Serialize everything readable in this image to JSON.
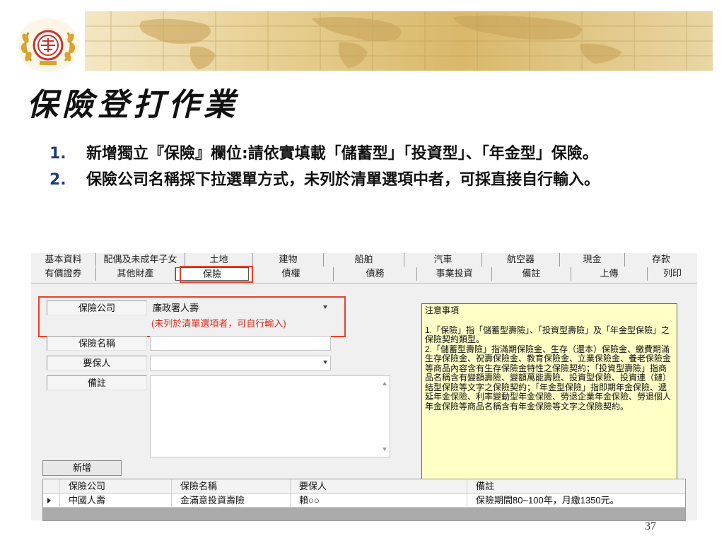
{
  "slide": {
    "title": "保險登打作業",
    "bullets": [
      {
        "num": "1.",
        "text": "新增獨立『保險』欄位:請依實填載「儲蓄型」「投資型」、「年金型」保險。"
      },
      {
        "num": "2.",
        "text": "保險公司名稱採下拉選單方式，未列於清單選項中者，可採直接自行輸入。"
      }
    ],
    "page_number": "37"
  },
  "colors": {
    "accent_red": "#e8412a",
    "hint_red": "#d62a1a",
    "notice_bg": "#ffffc6",
    "bullet_num": "#1f3d7a"
  },
  "icons": {
    "logo": "judicial-yuan-emblem-icon",
    "dropdown": "chevron-down-icon",
    "row_pointer": "row-pointer-icon"
  },
  "app": {
    "tabs_row1": [
      "基本資料",
      "配偶及未成年子女",
      "土地",
      "建物",
      "船舶",
      "汽車",
      "航空器",
      "現金",
      "存款"
    ],
    "tabs_row2": [
      "有價證券",
      "其他財產",
      "保險",
      "債權",
      "債務",
      "事業投資",
      "備註",
      "上傳",
      "列印"
    ],
    "active_tab": "保險",
    "form": {
      "company_label": "保險公司",
      "company_value": "廉政署人壽",
      "company_hint": "(未列於清單選項者，可自行輸入)",
      "name_label": "保險名稱",
      "name_value": "",
      "insured_label": "要保人",
      "insured_value": "",
      "notes_label": "備註",
      "notes_value": ""
    },
    "notice": {
      "title": "注意事項",
      "item1": "1.「保險」指「儲蓄型壽險」、「投資型壽險」及「年金型保險」之保險契約類型。",
      "item2": "2.「儲蓄型壽險」指滿期保險金、生存（還本）保險金、繳費期滿生存保險金、祝壽保險金、教育保險金、立業保險金、養老保險金等商品內容含有生存保險金特性之保險契約；「投資型壽險」指商品名稱含有變額壽險、變額萬能壽險、投資型保險、投資連（鏈）結型保險等文字之保險契約；「年金型保險」指即期年金保險、遞延年金保險、利率變動型年金保險、勞退企業年金保險、勞退個人年金保險等商品名稱含有年金保險等文字之保險契約。"
    },
    "add_button": "新增",
    "table": {
      "headers": [
        "保險公司",
        "保險名稱",
        "要保人",
        "備註"
      ],
      "rows": [
        [
          "中國人壽",
          "金滿意投資壽險",
          "賴○○",
          "保險期間80~100年，月繳1350元。"
        ]
      ]
    }
  }
}
